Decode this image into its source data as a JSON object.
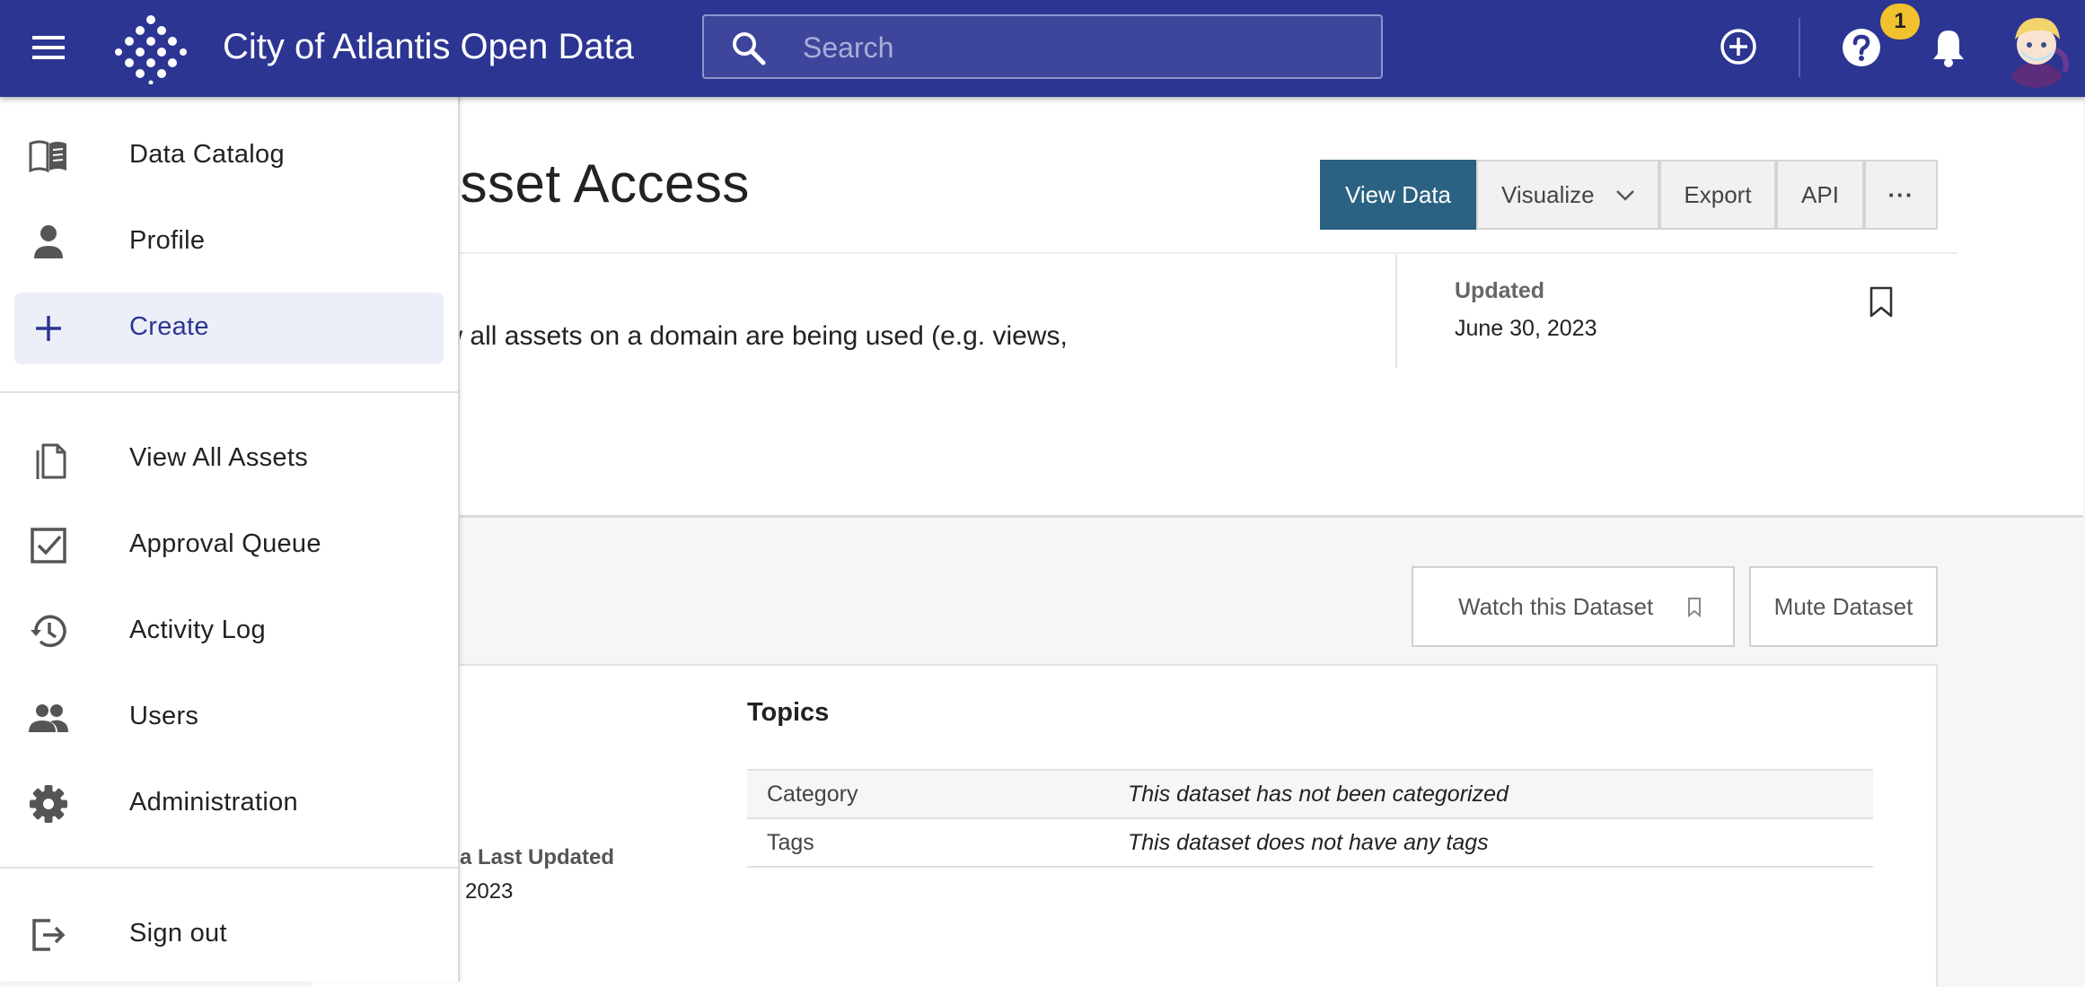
{
  "header": {
    "site_title": "City of Atlantis Open Data",
    "search_placeholder": "Search",
    "help_badge_count": "1"
  },
  "dataset": {
    "title_fragment": "cs: Asset Access",
    "description_fragment": "ail on how all assets on a domain are being used (e.g. views,",
    "updated_label": "Updated",
    "updated_value": "June 30, 2023"
  },
  "toolbar": {
    "view_data": "View Data",
    "visualize": "Visualize",
    "export": "Export",
    "api": "API",
    "more": "···"
  },
  "subscription": {
    "watch_label": "Watch this Dataset",
    "mute_label": "Mute Dataset"
  },
  "about": {
    "last_updated_label": "a Last Updated",
    "last_updated_value": "2023"
  },
  "topics": {
    "title": "Topics",
    "rows": [
      {
        "key": "Category",
        "value": "This dataset has not been categorized"
      },
      {
        "key": "Tags",
        "value": "This dataset does not have any tags"
      }
    ]
  },
  "drawer": {
    "items": [
      {
        "label": "Data Catalog",
        "icon": "book-open-icon"
      },
      {
        "label": "Profile",
        "icon": "person-icon"
      },
      {
        "label": "Create",
        "icon": "plus-icon",
        "active": true
      },
      {
        "label": "View All Assets",
        "icon": "files-icon"
      },
      {
        "label": "Approval Queue",
        "icon": "checkbox-icon"
      },
      {
        "label": "Activity Log",
        "icon": "history-icon"
      },
      {
        "label": "Users",
        "icon": "people-icon"
      },
      {
        "label": "Administration",
        "icon": "gear-icon"
      },
      {
        "label": "Sign out",
        "icon": "sign-out-icon"
      }
    ]
  },
  "colors": {
    "header_bg": "#2c3592",
    "primary_button": "#2b6282",
    "badge": "#f2c12e",
    "active_nav_bg": "#eceef8"
  }
}
